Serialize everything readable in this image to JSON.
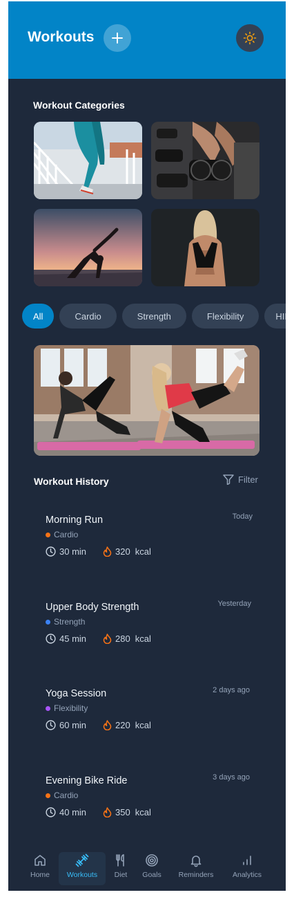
{
  "header": {
    "title": "Workouts"
  },
  "categories": {
    "title": "Workout Categories"
  },
  "filters": {
    "chips": [
      "All",
      "Cardio",
      "Strength",
      "Flexibility",
      "HIIT"
    ]
  },
  "history": {
    "title": "Workout History",
    "filter_label": "Filter",
    "entries": [
      {
        "name": "Morning Run",
        "category": "Cardio",
        "category_color": "#f97316",
        "duration": "30 min",
        "calories": "320",
        "unit": "kcal",
        "date": "Today"
      },
      {
        "name": "Upper Body Strength",
        "category": "Strength",
        "category_color": "#3b82f6",
        "duration": "45 min",
        "calories": "280",
        "unit": "kcal",
        "date": "Yesterday"
      },
      {
        "name": "Yoga Session",
        "category": "Flexibility",
        "category_color": "#a855f7",
        "duration": "60 min",
        "calories": "220",
        "unit": "kcal",
        "date": "2 days ago"
      },
      {
        "name": "Evening Bike Ride",
        "category": "Cardio",
        "category_color": "#f97316",
        "duration": "40 min",
        "calories": "350",
        "unit": "kcal",
        "date": "3 days ago"
      }
    ]
  },
  "nav": {
    "items": [
      {
        "label": "Home",
        "icon": "home-icon"
      },
      {
        "label": "Workouts",
        "icon": "dumbbell-icon"
      },
      {
        "label": "Diet",
        "icon": "utensils-icon"
      },
      {
        "label": "Goals",
        "icon": "target-icon"
      },
      {
        "label": "Reminders",
        "icon": "bell-icon"
      },
      {
        "label": "Analytics",
        "icon": "bar-chart-icon"
      }
    ],
    "active": "Workouts"
  },
  "colors": {
    "primary": "#0284c7",
    "background": "#1e293b",
    "surface": "#334155",
    "accent_active": "#38bdf8",
    "calorie": "#f97316"
  }
}
